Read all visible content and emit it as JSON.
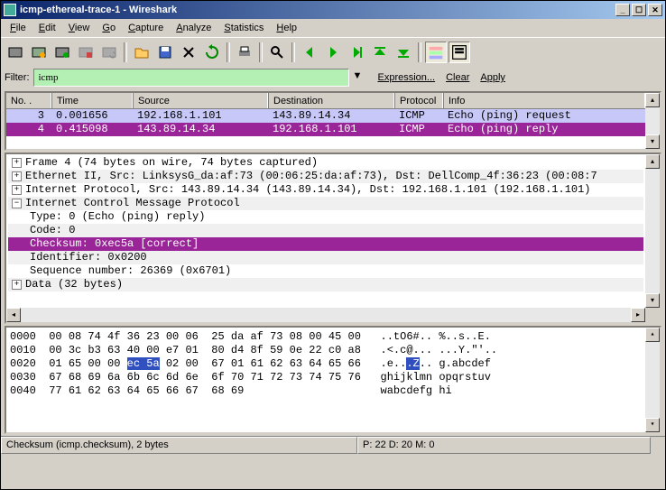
{
  "titlebar": {
    "title": "icmp-ethereal-trace-1 - Wireshark"
  },
  "win_buttons": {
    "min": "_",
    "max": "☐",
    "close": "✕"
  },
  "menu": {
    "file": "File",
    "edit": "Edit",
    "view": "View",
    "go": "Go",
    "capture": "Capture",
    "analyze": "Analyze",
    "statistics": "Statistics",
    "help": "Help"
  },
  "filter": {
    "label": "Filter:",
    "value": "icmp",
    "expression": "Expression...",
    "clear": "Clear",
    "apply": "Apply"
  },
  "packet_headers": {
    "no": "No. .",
    "time": "Time",
    "src": "Source",
    "dst": "Destination",
    "proto": "Protocol",
    "info": "Info"
  },
  "packets": [
    {
      "no": "3",
      "time": "0.001656",
      "src": "192.168.1.101",
      "dst": "143.89.14.34",
      "proto": "ICMP",
      "info": "Echo (ping) request",
      "cls": "sel1"
    },
    {
      "no": "4",
      "time": "0.415098",
      "src": "143.89.14.34",
      "dst": "192.168.1.101",
      "proto": "ICMP",
      "info": "Echo (ping) reply",
      "cls": "sel2"
    }
  ],
  "details": {
    "frame": "Frame 4 (74 bytes on wire, 74 bytes captured)",
    "eth": "Ethernet II, Src: LinksysG_da:af:73 (00:06:25:da:af:73), Dst: DellComp_4f:36:23 (00:08:7",
    "ip": "Internet Protocol, Src: 143.89.14.34 (143.89.14.34), Dst: 192.168.1.101 (192.168.1.101)",
    "icmp": "Internet Control Message Protocol",
    "type": "Type: 0 (Echo (ping) reply)",
    "code": "Code: 0",
    "checksum": "Checksum: 0xec5a [correct]",
    "ident": "Identifier: 0x0200",
    "seq": "Sequence number: 26369 (0x6701)",
    "data": "Data (32 bytes)"
  },
  "hex": {
    "r0": {
      "off": "0000",
      "b1": "00 08 74 4f 36 23 00 06",
      "b2": "25 da af 73 08 00 45 00",
      "a": "..tO6#.. %..s..E."
    },
    "r1": {
      "off": "0010",
      "b1": "00 3c b3 63 40 00 e7 01",
      "b2": "80 d4 8f 59 0e 22 c0 a8",
      "a": ".<.c@... ...Y.\"'.."
    },
    "r2": {
      "off": "0020",
      "b1a": "01 65 00 00 ",
      "hl": "ec 5a",
      "b1b": " 02 00",
      "b2": "67 01 61 62 63 64 65 66",
      "a1": ".e..",
      "ahl": ".Z",
      "a2": ".. g.abcdef"
    },
    "r3": {
      "off": "0030",
      "b1": "67 68 69 6a 6b 6c 6d 6e",
      "b2": "6f 70 71 72 73 74 75 76",
      "a": "ghijklmn opqrstuv"
    },
    "r4": {
      "off": "0040",
      "b1": "77 61 62 63 64 65 66 67",
      "b2": "68 69",
      "a": "wabcdefg hi"
    }
  },
  "status": {
    "left": "Checksum (icmp.checksum), 2 bytes",
    "right": "P: 22 D: 20 M: 0"
  }
}
